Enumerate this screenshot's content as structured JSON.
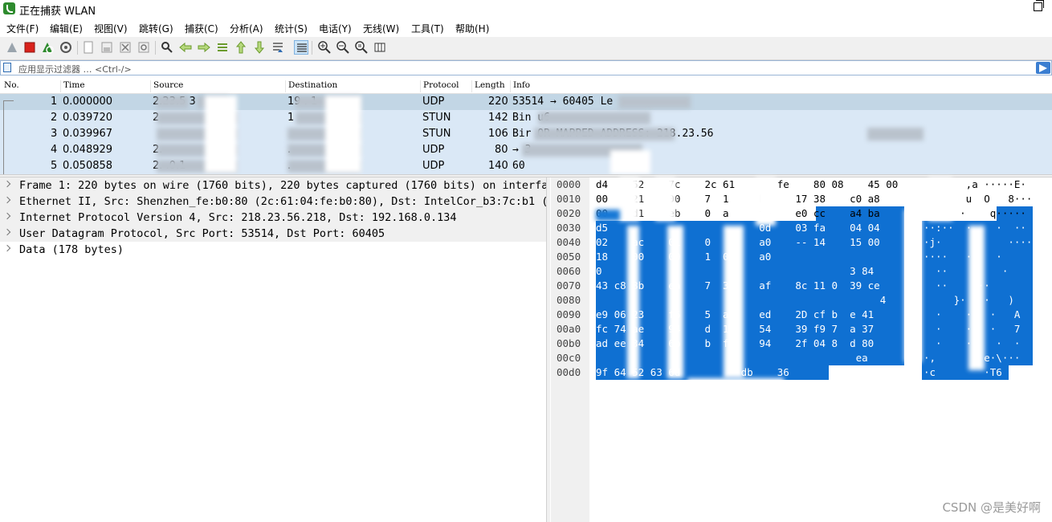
{
  "window": {
    "title": "正在捕获 WLAN"
  },
  "menu": [
    "文件(F)",
    "编辑(E)",
    "视图(V)",
    "跳转(G)",
    "捕获(C)",
    "分析(A)",
    "统计(S)",
    "电话(Y)",
    "无线(W)",
    "工具(T)",
    "帮助(H)"
  ],
  "toolbar": {
    "icons": [
      "start-capture-icon",
      "stop-capture-icon",
      "restart-capture-icon",
      "capture-options-icon",
      "open-file-icon",
      "save-file-icon",
      "close-file-icon",
      "reload-file-icon",
      "find-packet-icon",
      "go-back-icon",
      "go-forward-icon",
      "go-to-packet-icon",
      "go-first-icon",
      "go-last-icon",
      "auto-scroll-icon",
      "colorize-icon",
      "zoom-in-icon",
      "zoom-out-icon",
      "normal-size-icon",
      "resize-columns-icon"
    ]
  },
  "filter": {
    "placeholder": "应用显示过滤器 … <Ctrl-/>"
  },
  "packet_list": {
    "columns": [
      "No.",
      "Time",
      "Source",
      "Destination",
      "Protocol",
      "Length",
      "Info"
    ],
    "rows": [
      {
        "no": "1",
        "time": "0.000000",
        "src": "2.23.5   3",
        "dst": "19    .  1",
        "proto": "UDP",
        "len": "220",
        "info": "53514 → 60405 Le"
      },
      {
        "no": "2",
        "time": "0.039720",
        "src": "2",
        "dst": "1",
        "proto": "STUN",
        "len": "142",
        "info": "Bin                u6"
      },
      {
        "no": "3",
        "time": "0.039967",
        "src": "",
        "dst": "",
        "proto": "STUN",
        "len": "106",
        "info": "Bir                  OR-MAPPED-ADDRESS: 218.23.56"
      },
      {
        "no": "4",
        "time": "0.048929",
        "src": "2.",
        "dst": ".",
        "proto": "UDP",
        "len": "80",
        "info": "    →            3"
      },
      {
        "no": "5",
        "time": "0.050858",
        "src": "2.    .0.1",
        "dst": ".",
        "proto": "UDP",
        "len": "140",
        "info": "60"
      }
    ]
  },
  "details": [
    "Frame 1: 220 bytes on wire (1760 bits), 220 bytes captured (1760 bits) on interfac",
    "Ethernet II, Src: Shenzhen_fe:b0:80 (2c:61:04:fe:b0:80), Dst: IntelCor_b3:7c:b1 (d",
    "Internet Protocol Version 4, Src: 218.23.56.218, Dst: 192.168.0.134",
    "User Datagram Protocol, Src Port: 53514, Dst Port: 60405",
    "Data (178 bytes)"
  ],
  "bytes": {
    "rows": [
      {
        "off": "0000",
        "hex": "d4    52    7c    2c 61       fe    80 08    45 00",
        "ascii": "  ·    ,a ·····E·"
      },
      {
        "off": "0010",
        "hex": "00    21    00    7  1     b2    17 38    c0 a8",
        "ascii": "  ·    u  O   8···"
      },
      {
        "off": "0020",
        "hex": "00    d1    eb    0  a     fe    e0 cc    a4 ba",
        "ascii": "  ·   ·    q·····"
      },
      {
        "off": "0030",
        "hex": "d5                         0d    03 fa    04 04",
        "ascii": "··:··  ·    ·  ··"
      },
      {
        "off": "0040",
        "hex": "02    ac    01    0        a0    -- 14    15 00",
        "ascii": "·j·           ····"
      },
      {
        "off": "0050",
        "hex": "18    00    00    1  0     a0",
        "ascii": "····   ·    ·"
      },
      {
        "off": "0060",
        "hex": "0                                         3 84",
        "ascii": "  ··    ·    ·"
      },
      {
        "off": "0070",
        "hex": "43 c8 8b    ea    7  3     af    8c 11 0  39 ce",
        "ascii": "  ··    ···"
      },
      {
        "off": "0080",
        "hex": "                                               4",
        "ascii": "     }·   ·   )"
      },
      {
        "off": "0090",
        "hex": "e9 06 23    f6    5  a     ed    2D cf b  e 41",
        "ascii": "  ·    ·   ·   A"
      },
      {
        "off": "00a0",
        "hex": "fc 74 ae    94    d  1     54    39 f9 7  a 37",
        "ascii": "  ·    ·   ·   7"
      },
      {
        "off": "00b0",
        "hex": "ad ee 34    6b    b  fb    94    2f 04 8  d 80",
        "ascii": "  ·    ·    ·  ·"
      },
      {
        "off": "00c0",
        "hex": "                                           ea",
        "ascii": "·,        e·\\···"
      },
      {
        "off": "00d0",
        "hex": "9f 64 52 63 6d          db    36",
        "ascii": "·c        ·T6"
      }
    ]
  },
  "watermark": "CSDN @是美好啊",
  "colors": {
    "list_bg": "#dae8f6",
    "selected_row": "#c2d6e5",
    "byte_highlight": "#0f70d2",
    "details_bg": "#f0f0f0"
  }
}
